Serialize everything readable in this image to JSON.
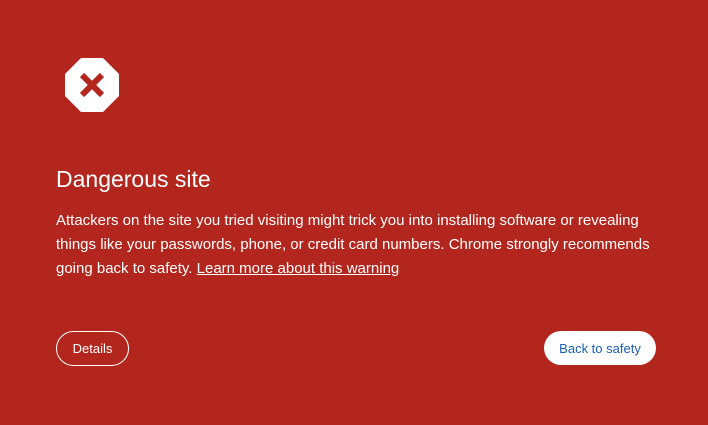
{
  "colors": {
    "background": "#b3261e",
    "text": "#ffffff",
    "primary_button_text": "#1a5fb4"
  },
  "icon": {
    "name": "danger-x-octagon-icon"
  },
  "heading": {
    "title": "Dangerous site"
  },
  "body": {
    "description": "Attackers on the site you tried visiting might trick you into installing software or revealing things like your passwords, phone, or credit card numbers. Chrome strongly recommends going back to safety. ",
    "learn_more_link": "Learn more about this warning"
  },
  "actions": {
    "details_label": "Details",
    "back_to_safety_label": "Back to safety"
  }
}
